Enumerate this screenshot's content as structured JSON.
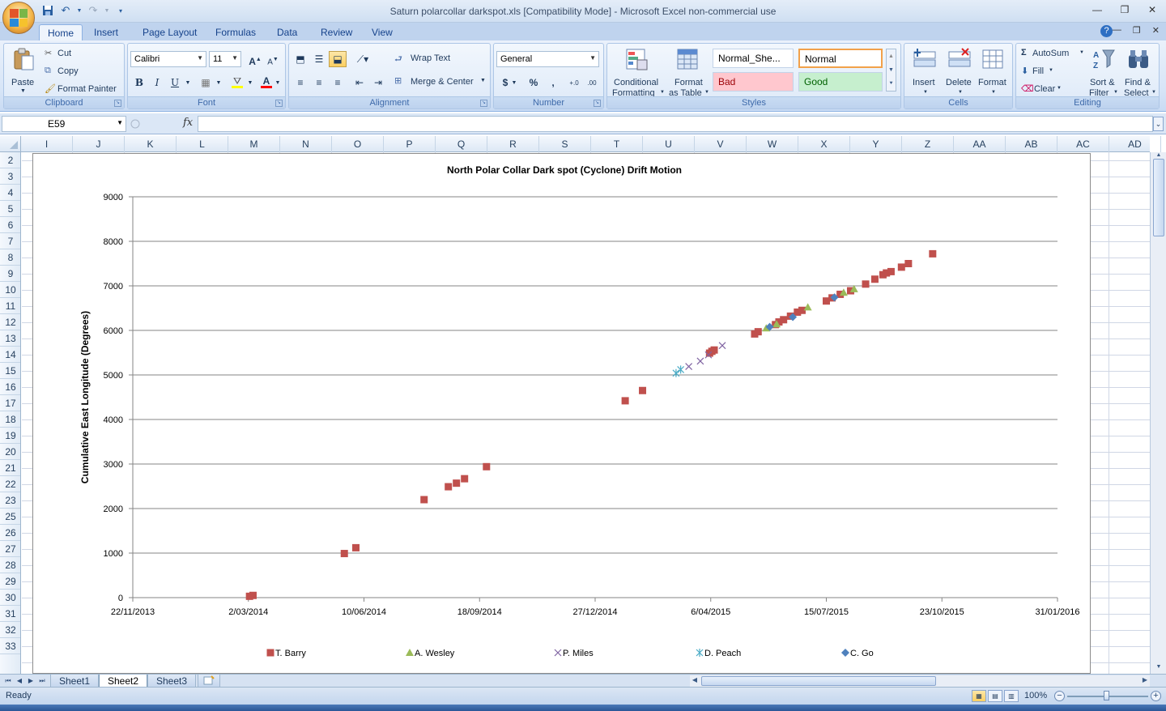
{
  "window": {
    "title": "Saturn polarcollar darkspot.xls  [Compatibility Mode] - Microsoft Excel non-commercial use"
  },
  "ribbon_tabs": [
    "Home",
    "Insert",
    "Page Layout",
    "Formulas",
    "Data",
    "Review",
    "View"
  ],
  "clipboard": {
    "paste": "Paste",
    "cut": "Cut",
    "copy": "Copy",
    "format_painter": "Format Painter",
    "label": "Clipboard"
  },
  "font": {
    "name": "Calibri",
    "size": "11",
    "label": "Font",
    "bold": "B",
    "italic": "I",
    "underline": "U"
  },
  "alignment": {
    "wrap_text": "Wrap Text",
    "merge_center": "Merge & Center",
    "label": "Alignment"
  },
  "number": {
    "format": "General",
    "label": "Number"
  },
  "styles": {
    "conditional_formatting_1": "Conditional",
    "conditional_formatting_2": "Formatting",
    "format_as_table_1": "Format",
    "format_as_table_2": "as Table",
    "normal_sheet": "Normal_She...",
    "normal": "Normal",
    "bad": "Bad",
    "good": "Good",
    "label": "Styles"
  },
  "cells": {
    "insert": "Insert",
    "delete": "Delete",
    "format": "Format",
    "label": "Cells"
  },
  "editing": {
    "autosum": "AutoSum",
    "fill": "Fill",
    "clear": "Clear",
    "sort_filter_1": "Sort &",
    "sort_filter_2": "Filter",
    "find_select_1": "Find &",
    "find_select_2": "Select",
    "label": "Editing"
  },
  "formula_bar": {
    "name_box": "E59",
    "fx": "fx",
    "formula": ""
  },
  "columns": [
    "I",
    "J",
    "K",
    "L",
    "M",
    "N",
    "O",
    "P",
    "Q",
    "R",
    "S",
    "T",
    "U",
    "V",
    "W",
    "X",
    "Y",
    "Z",
    "AA",
    "AB",
    "AC",
    "AD"
  ],
  "rows": [
    "2",
    "3",
    "4",
    "5",
    "6",
    "7",
    "8",
    "9",
    "10",
    "11",
    "12",
    "13",
    "14",
    "15",
    "16",
    "17",
    "18",
    "19",
    "20",
    "21",
    "22",
    "23",
    "25",
    "26",
    "27",
    "28",
    "29",
    "30",
    "31",
    "32",
    "33"
  ],
  "sheets": [
    "Sheet1",
    "Sheet2",
    "Sheet3"
  ],
  "active_sheet": "Sheet2",
  "status": {
    "text": "Ready",
    "zoom": "100%"
  },
  "colors": {
    "t_barry": "#c0504d",
    "a_wesley": "#9bbb59",
    "p_miles": "#8064a2",
    "d_peach": "#4bacc6",
    "c_go": "#4f81bd"
  },
  "chart_data": {
    "type": "scatter",
    "title": "North Polar Collar Dark spot (Cyclone) Drift Motion",
    "xlabel": "",
    "ylabel": "Cumulative East Longitude (Degrees)",
    "x_ticks": [
      "22/11/2013",
      "2/03/2014",
      "10/06/2014",
      "18/09/2014",
      "27/12/2014",
      "6/04/2015",
      "15/07/2015",
      "23/10/2015",
      "31/01/2016"
    ],
    "xlim": [
      "2013-11-22",
      "2016-01-31"
    ],
    "ylim": [
      0,
      9000
    ],
    "y_ticks": [
      0,
      1000,
      2000,
      3000,
      4000,
      5000,
      6000,
      7000,
      8000,
      9000
    ],
    "grid": "horizontal",
    "legend": "bottom",
    "series": [
      {
        "name": "T. Barry",
        "marker": "square",
        "points": [
          [
            "2014-03-03",
            30
          ],
          [
            "2014-03-06",
            50
          ],
          [
            "2014-05-24",
            990
          ],
          [
            "2014-06-03",
            1120
          ],
          [
            "2014-08-01",
            2200
          ],
          [
            "2014-08-22",
            2490
          ],
          [
            "2014-08-29",
            2570
          ],
          [
            "2014-09-05",
            2670
          ],
          [
            "2014-09-24",
            2940
          ],
          [
            "2015-01-22",
            4420
          ],
          [
            "2015-02-06",
            4650
          ],
          [
            "2015-04-05",
            5490
          ],
          [
            "2015-04-07",
            5530
          ],
          [
            "2015-04-09",
            5560
          ],
          [
            "2015-05-14",
            5920
          ],
          [
            "2015-05-17",
            5970
          ],
          [
            "2015-06-01",
            6130
          ],
          [
            "2015-06-04",
            6190
          ],
          [
            "2015-06-08",
            6240
          ],
          [
            "2015-06-14",
            6320
          ],
          [
            "2015-06-20",
            6410
          ],
          [
            "2015-06-24",
            6450
          ],
          [
            "2015-07-15",
            6660
          ],
          [
            "2015-07-20",
            6730
          ],
          [
            "2015-07-27",
            6810
          ],
          [
            "2015-08-05",
            6890
          ],
          [
            "2015-08-18",
            7040
          ],
          [
            "2015-08-26",
            7150
          ],
          [
            "2015-09-02",
            7250
          ],
          [
            "2015-09-05",
            7290
          ],
          [
            "2015-09-09",
            7320
          ],
          [
            "2015-09-18",
            7420
          ],
          [
            "2015-09-24",
            7500
          ],
          [
            "2015-10-15",
            7720
          ]
        ]
      },
      {
        "name": "A. Wesley",
        "marker": "triangle",
        "points": [
          [
            "2015-05-24",
            6050
          ],
          [
            "2015-06-02",
            6140
          ],
          [
            "2015-06-29",
            6520
          ],
          [
            "2015-07-30",
            6850
          ],
          [
            "2015-08-08",
            6930
          ]
        ]
      },
      {
        "name": "P. Miles",
        "marker": "x",
        "points": [
          [
            "2015-03-18",
            5190
          ],
          [
            "2015-03-28",
            5310
          ],
          [
            "2015-04-04",
            5450
          ],
          [
            "2015-04-16",
            5660
          ]
        ]
      },
      {
        "name": "D. Peach",
        "marker": "star",
        "points": [
          [
            "2015-03-07",
            5040
          ],
          [
            "2015-03-11",
            5120
          ]
        ]
      },
      {
        "name": "C. Go",
        "marker": "diamond",
        "points": [
          [
            "2015-05-27",
            6080
          ],
          [
            "2015-06-16",
            6300
          ],
          [
            "2015-07-22",
            6740
          ]
        ]
      }
    ]
  }
}
